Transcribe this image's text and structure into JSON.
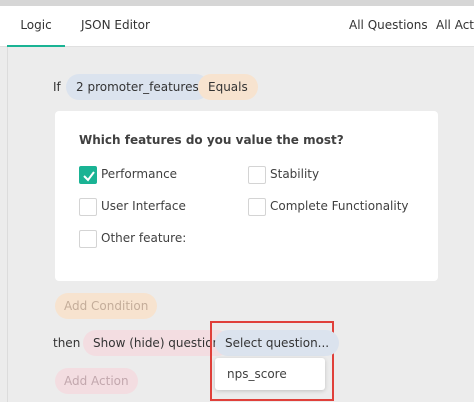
{
  "tabs": {
    "logic": "Logic",
    "json_editor": "JSON Editor",
    "all_questions": "All Questions",
    "all_actions": "All Actio"
  },
  "condition": {
    "if_label": "If",
    "question": "2 promoter_features",
    "operator": "Equals"
  },
  "card": {
    "title": "Which features do you value the most?",
    "options": [
      {
        "label": "Performance",
        "checked": true
      },
      {
        "label": "Stability",
        "checked": false
      },
      {
        "label": "User Interface",
        "checked": false
      },
      {
        "label": "Complete Functionality",
        "checked": false
      },
      {
        "label": "Other feature:",
        "checked": false
      }
    ]
  },
  "add_condition_label": "Add Condition",
  "action": {
    "then_label": "then",
    "type": "Show (hide) question",
    "select_placeholder": "Select question...",
    "dropdown_items": [
      "nps_score"
    ]
  },
  "add_action_label": "Add Action",
  "colors": {
    "accent": "#1ab394",
    "highlight_border": "#e0403a"
  },
  "icons": {
    "checkbox_checked": "checkmark-icon"
  }
}
